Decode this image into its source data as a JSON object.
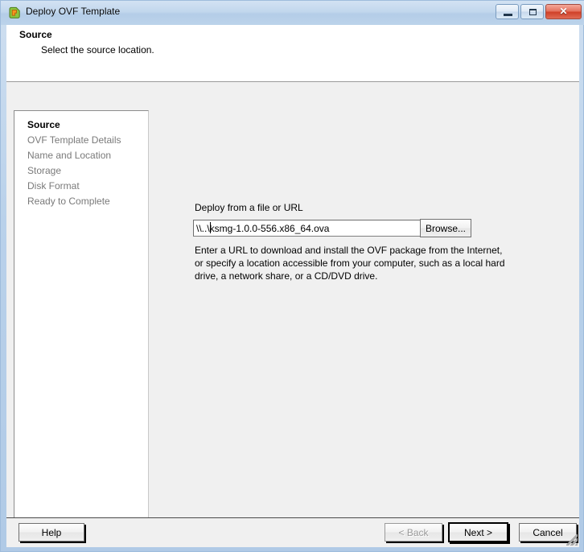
{
  "window": {
    "title": "Deploy OVF Template",
    "icon": "ovf-template-icon",
    "controls": {
      "minimize": "–",
      "maximize": "□",
      "close": "✕"
    }
  },
  "header": {
    "title": "Source",
    "subtitle": "Select the source location."
  },
  "sidebar": {
    "items": [
      {
        "label": "Source",
        "active": true
      },
      {
        "label": "OVF Template Details",
        "active": false
      },
      {
        "label": "Name and Location",
        "active": false
      },
      {
        "label": "Storage",
        "active": false
      },
      {
        "label": "Disk Format",
        "active": false
      },
      {
        "label": "Ready to Complete",
        "active": false
      }
    ]
  },
  "content": {
    "field_label": "Deploy from a file or URL",
    "source_value": "\\\\..\\ksmg-1.0.0-556.x86_64.ova",
    "source_placeholder": "",
    "browse_label": "Browse...",
    "description": "Enter a URL to download and install the OVF package from the Internet, or specify a location accessible from your computer, such as a local hard drive, a network share, or a CD/DVD drive."
  },
  "footer": {
    "help_label": "Help",
    "back_label": "< Back",
    "next_label": "Next >",
    "cancel_label": "Cancel"
  },
  "colors": {
    "title_bar": "#b9d1ea",
    "client_bg": "#f0f0f0",
    "panel_bg": "#ffffff",
    "close_button": "#cf3f27",
    "disabled_text": "#9a9a9a"
  }
}
